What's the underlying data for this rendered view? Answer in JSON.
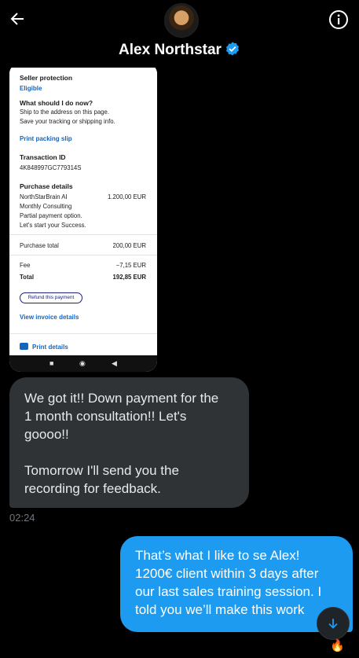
{
  "header": {
    "name": "Alex Northstar"
  },
  "attachment": {
    "seller_protection_label": "Seller protection",
    "seller_protection_value": "Eligible",
    "what_to_do_label": "What should I do now?",
    "what_to_do_line1": "Ship to the address on this page.",
    "what_to_do_line2": "Save your tracking or shipping info.",
    "print_packing_slip": "Print packing slip",
    "transaction_label": "Transaction ID",
    "transaction_id": "4K848997GC779314S",
    "purchase_details_label": "Purchase details",
    "item_name": "NorthStarBrain AI",
    "item_amount": "1.200,00 EUR",
    "item_line2": "Monthly Consulting",
    "item_line3": "Partial payment option.",
    "item_line4": "Let's start your Success.",
    "purchase_total_label": "Purchase total",
    "purchase_total_value": "200,00 EUR",
    "fee_label": "Fee",
    "fee_value": "−7,15 EUR",
    "total_label": "Total",
    "total_value": "192,85 EUR",
    "refund_button": "Refund this payment",
    "view_invoice": "View invoice details",
    "print_details": "Print details"
  },
  "messages": [
    {
      "text": "We got it!! Down payment for the\n1 month consultation!! Let's\ngoooo!!\n\nTomorrow I'll send you the\nrecording for feedback.",
      "time": "02:24"
    },
    {
      "text": "That’s what I like to se Alex!\n1200€ client within 3 days after\nour last sales training session. I\ntold you we’ll make this work",
      "reaction": "🔥"
    }
  ],
  "colors": {
    "accent": "#1d9bf0",
    "incoming_bubble": "#2f3336",
    "background": "#000000"
  }
}
